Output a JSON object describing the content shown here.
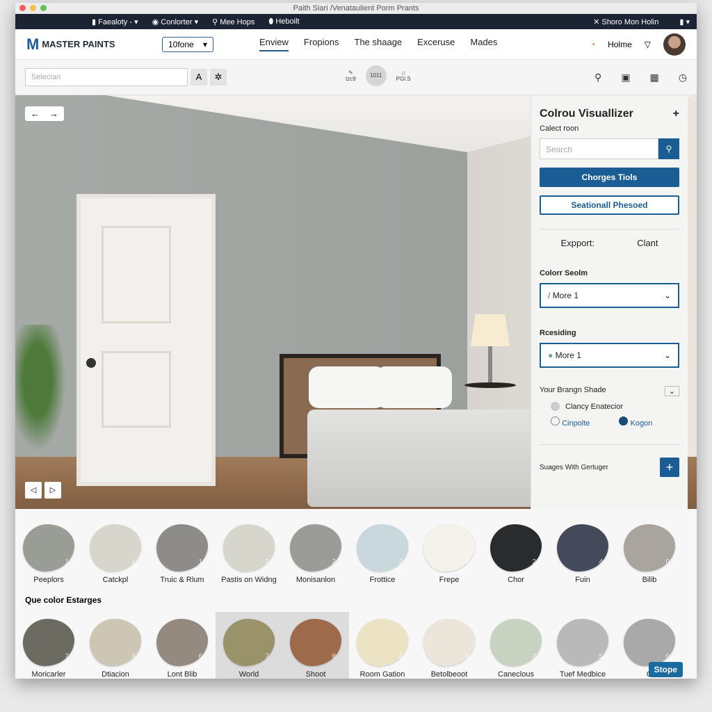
{
  "window": {
    "title": "Paith Siari /Venataulient Porm Prants"
  },
  "topnav": {
    "items": [
      "Faealoty -",
      "Conlorter",
      "Mee Hops",
      "Heboilt"
    ],
    "right": "Shoro Mon Holin"
  },
  "header": {
    "brand": "MASTER PAINTS",
    "select": "10fone",
    "nav": [
      "Enview",
      "Fropions",
      "The shaage",
      "Exceruse",
      "Mades"
    ],
    "user": "Holme"
  },
  "toolbar": {
    "search_placeholder": "Selecian",
    "tool_labels": [
      "tzc9",
      "1011",
      "PGl.S"
    ]
  },
  "panel": {
    "title": "Colrou Visuallizer",
    "subtitle": "Calect roon",
    "search_placeholder": "Search",
    "primary": "Chorges Tiols",
    "secondary": "Seationall Phesoed",
    "export": "Expport:",
    "export_value": "Clant",
    "color_label": "Colorr Seolm",
    "color_value": "More 1",
    "res_label": "Rcesiding",
    "res_value": "More 1",
    "brand_label": "Your Brangn Shade",
    "radio1": "Clancy Enatecior",
    "radio2": "Cinpolte",
    "radio3": "Kogon",
    "shades_label": "Suages With Gertuger"
  },
  "swatches": {
    "row1": [
      {
        "name": "Peeplors",
        "num": "1",
        "color": "#9a9d96"
      },
      {
        "name": "Catckpl",
        "num": "1",
        "color": "#d8d5cc"
      },
      {
        "name": "Truic & Rlum",
        "num": "1",
        "color": "#8d8c88"
      },
      {
        "name": "Pastis on Widng",
        "num": "2",
        "color": "#d6d6cc"
      },
      {
        "name": "Monisanlon",
        "num": "2",
        "color": "#9b9c98"
      },
      {
        "name": "Frottice",
        "num": "3",
        "color": "#c8d8dc"
      },
      {
        "name": "Frepe",
        "num": "3",
        "color": "#f4f2ea"
      },
      {
        "name": "Chor",
        "num": "2",
        "color": "#2a2b2d"
      },
      {
        "name": "Fuin",
        "num": "4",
        "color": "#454a5a"
      },
      {
        "name": "Bilib",
        "num": "0",
        "color": "#aaa49e"
      }
    ],
    "section_title": "Que color Estarges",
    "row2": [
      {
        "name": "Moricarler",
        "num": "7",
        "color": "#6b6b62"
      },
      {
        "name": "Dtiacion",
        "num": "6",
        "color": "#cdc6b4"
      },
      {
        "name": "Lont Blib",
        "num": "6",
        "color": "#958a80"
      },
      {
        "name": "World",
        "num": "7",
        "color": "#9a9268"
      },
      {
        "name": "Shoot",
        "num": "8",
        "color": "#9e6a4c"
      },
      {
        "name": "Room Gation",
        "num": "2",
        "color": "#ece3c4"
      },
      {
        "name": "Betolbeoot",
        "num": "0",
        "color": "#ece6da"
      },
      {
        "name": "Caneclous",
        "num": "7",
        "color": "#c8d2c0"
      },
      {
        "name": "Tuef Medbice",
        "num": "5",
        "color": "#b9b9b9"
      },
      {
        "name": "O",
        "num": "0",
        "color": "#a9a9a9"
      }
    ],
    "stope": "Stope"
  },
  "colors": {
    "accent": "#1a5c94",
    "nav_bg": "#1c2433"
  }
}
